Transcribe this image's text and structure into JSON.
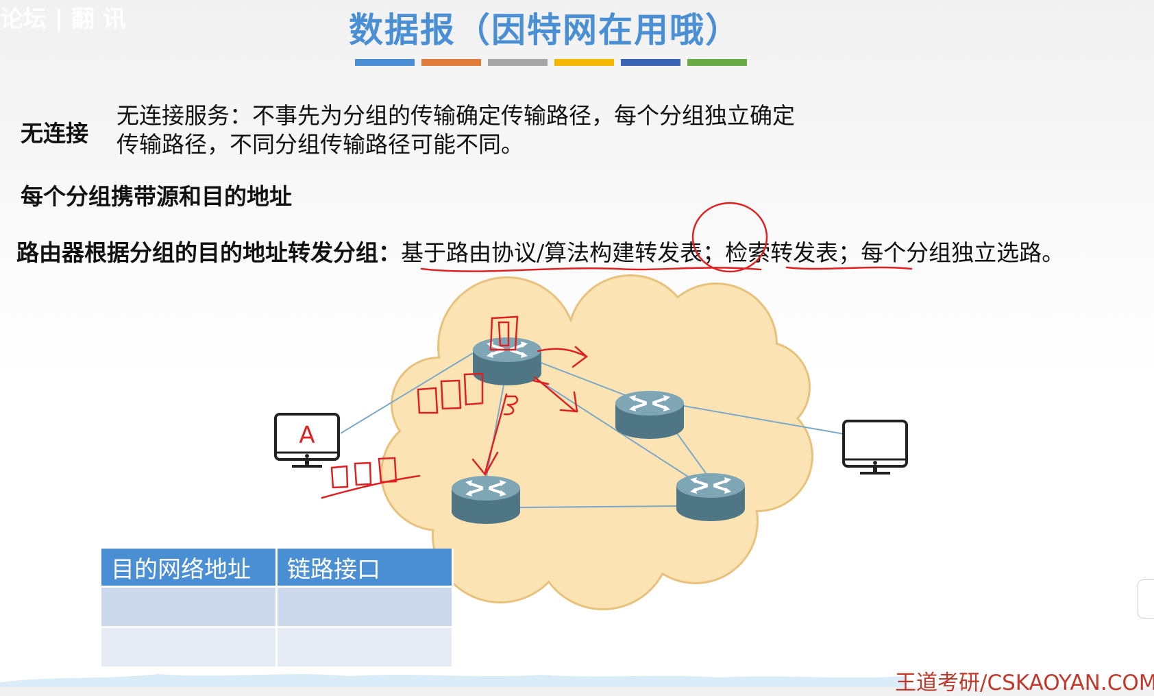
{
  "watermark_top_left": "论坛 | 翻 讯",
  "title": "数据报（因特网在用哦）",
  "colors": {
    "title": "#4a8fd4",
    "bar": [
      "#4a8fd4",
      "#e07b39",
      "#a5a5a5",
      "#f5b800",
      "#3b63b3",
      "#6aaa45"
    ],
    "annotation": "#e02020",
    "cloud_fill": "#fbe3b3",
    "cloud_stroke": "#e8c27c",
    "router": "#5f8a99",
    "table_header": "#4a8fd4"
  },
  "connectionless": {
    "label": "无连接",
    "desc_line1": "无连接服务：不事先为分组的传输确定传输路径，每个分组独立确定",
    "desc_line2": "传输路径，不同分组传输路径可能不同。"
  },
  "address_line": "每个分组携带源和目的地址",
  "routing": {
    "prefix": "路由器根据分组的目的地址转发分组：",
    "part1": "基于路由协议/算法构建转发表",
    "sep1": "；",
    "part2": "检索转发表",
    "sep2": "；",
    "part3": "每个分组独立选路。"
  },
  "diagram": {
    "host_a_label": "A",
    "icons": [
      "router-icon",
      "computer-icon"
    ]
  },
  "table": {
    "headers": [
      "目的网络地址",
      "链路接口"
    ],
    "rows": [
      [
        "",
        ""
      ],
      [
        "",
        ""
      ]
    ]
  },
  "footer_watermark": "王道考研/CSKAOYAN.COM"
}
